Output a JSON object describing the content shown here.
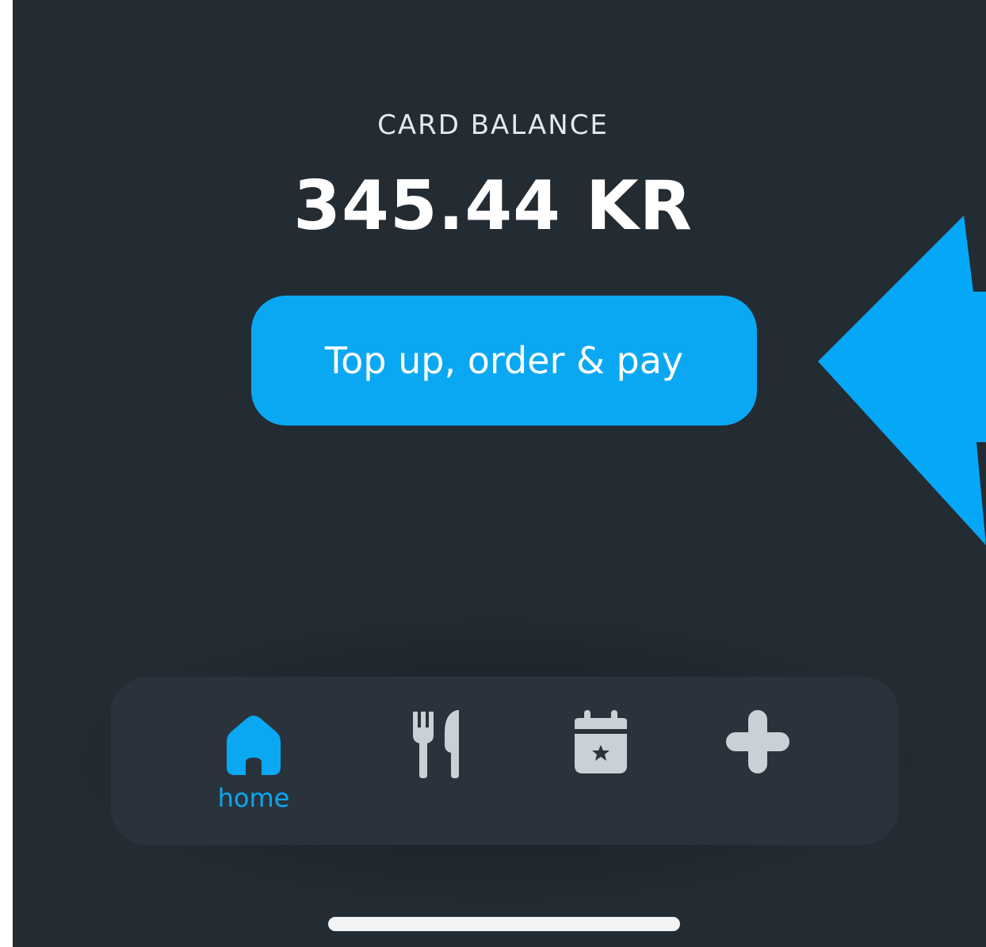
{
  "balance": {
    "label": "CARD BALANCE",
    "value": "345.44 KR"
  },
  "cta": {
    "label": "Top up, order & pay"
  },
  "nav": {
    "items": [
      {
        "id": "home",
        "label": "home",
        "icon": "home-icon",
        "active": true
      },
      {
        "id": "menu",
        "label": "",
        "icon": "fork-knife-icon",
        "active": false
      },
      {
        "id": "events",
        "label": "",
        "icon": "calendar-star-icon",
        "active": false
      },
      {
        "id": "more",
        "label": "",
        "icon": "plus-icon",
        "active": false
      }
    ]
  },
  "colors": {
    "background": "#232b33",
    "accent": "#0aa8f2",
    "nav_background": "#2a333c",
    "icon_inactive": "#c9d0d6",
    "text": "#ffffff"
  }
}
